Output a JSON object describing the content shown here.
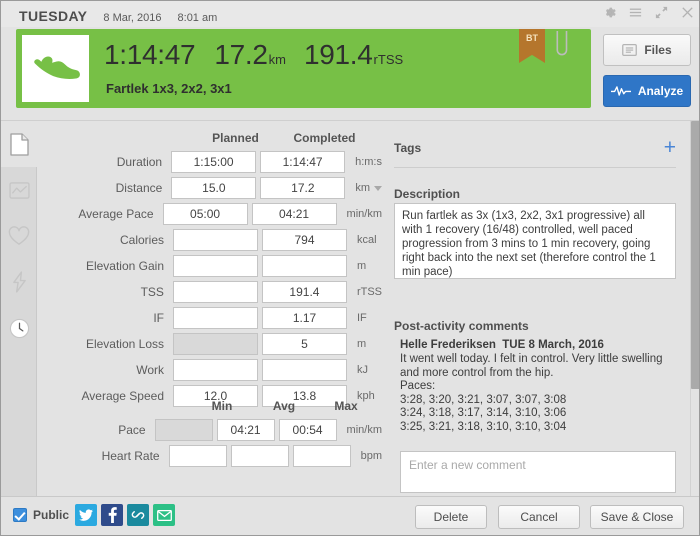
{
  "window": {
    "controls": [
      {
        "name": "gear-icon",
        "label": "Settings"
      },
      {
        "name": "menu-icon",
        "label": "Menu"
      },
      {
        "name": "expand-icon",
        "label": "Expand"
      },
      {
        "name": "close-icon",
        "label": "Close"
      }
    ]
  },
  "header": {
    "day_of_week": "TUESDAY",
    "date": "8 Mar, 2016",
    "time": "8:01 am",
    "banner_color": "#77c046",
    "activity_icon": "running-shoe-icon",
    "stats": [
      {
        "value": "1:14:47",
        "unit": ""
      },
      {
        "value": "17.2",
        "unit": "km"
      },
      {
        "value": "191.4",
        "unit": "rTSS"
      }
    ],
    "subtitle": "Fartlek 1x3, 2x2, 3x1",
    "badge": "BT",
    "attachment_icon": "paperclip-icon",
    "files_button": "Files",
    "analyze_button": "Analyze",
    "analyze_color": "#2f76c7"
  },
  "sidebar": {
    "items": [
      {
        "name": "document-icon",
        "label": "Summary",
        "active": true
      },
      {
        "name": "chart-icon",
        "label": "Graphs",
        "active": false
      },
      {
        "name": "heart-icon",
        "label": "Health",
        "active": false
      },
      {
        "name": "lightning-icon",
        "label": "Power",
        "active": false
      },
      {
        "name": "clock-icon",
        "label": "Laps",
        "active": false
      }
    ]
  },
  "form": {
    "columns": [
      "Planned",
      "Completed"
    ],
    "rows": [
      {
        "label": "Duration",
        "planned": "1:15:00",
        "completed": "1:14:47",
        "unit": "h:m:s",
        "unit_dropdown": false,
        "planned_disabled": false
      },
      {
        "label": "Distance",
        "planned": "15.0",
        "completed": "17.2",
        "unit": "km",
        "unit_dropdown": true,
        "planned_disabled": false
      },
      {
        "label": "Average Pace",
        "planned": "05:00",
        "completed": "04:21",
        "unit": "min/km",
        "unit_dropdown": false,
        "planned_disabled": false
      },
      {
        "label": "Calories",
        "planned": "",
        "completed": "794",
        "unit": "kcal",
        "unit_dropdown": false,
        "planned_disabled": false
      },
      {
        "label": "Elevation Gain",
        "planned": "",
        "completed": "",
        "unit": "m",
        "unit_dropdown": false,
        "planned_disabled": false
      },
      {
        "label": "TSS",
        "planned": "",
        "completed": "191.4",
        "unit": "rTSS",
        "unit_dropdown": false,
        "planned_disabled": false
      },
      {
        "label": "IF",
        "planned": "",
        "completed": "1.17",
        "unit": "IF",
        "unit_dropdown": false,
        "planned_disabled": false
      },
      {
        "label": "Elevation Loss",
        "planned": "",
        "completed": "5",
        "unit": "m",
        "unit_dropdown": false,
        "planned_disabled": true
      },
      {
        "label": "Work",
        "planned": "",
        "completed": "",
        "unit": "kJ",
        "unit_dropdown": false,
        "planned_disabled": false
      },
      {
        "label": "Average Speed",
        "planned": "12.0",
        "completed": "13.8",
        "unit": "kph",
        "unit_dropdown": false,
        "planned_disabled": false
      }
    ],
    "columns2": [
      "Min",
      "Avg",
      "Max"
    ],
    "rows2": [
      {
        "label": "Pace",
        "min": "",
        "avg": "04:21",
        "max": "00:54",
        "unit": "min/km",
        "min_disabled": true
      },
      {
        "label": "Heart Rate",
        "min": "",
        "avg": "",
        "max": "",
        "unit": "bpm",
        "min_disabled": false
      }
    ]
  },
  "right": {
    "tags_title": "Tags",
    "tags_add": "+",
    "description_title": "Description",
    "description_text": "Run fartlek as 3x (1x3, 2x2, 3x1 progressive) all with 1 recovery (16/48) controlled, well paced progression from 3 mins to 1 min recovery, going right back into the next set (therefore control the 1 min pace)",
    "comments_title": "Post-activity comments",
    "comment_author": "Helle Frederiksen",
    "comment_date": "TUE 8 March, 2016",
    "comment_body": "It went well today. I felt in control. Very little swelling and more control from the hip.\nPaces:\n3:28, 3:20, 3:21, 3:07, 3:07, 3:08\n3:24, 3:18, 3:17, 3:14, 3:10, 3:06\n3:25, 3:21, 3:18, 3:10, 3:10, 3:04",
    "new_comment_value": "",
    "new_comment_placeholder": "Enter a new comment"
  },
  "footer": {
    "public_label": "Public",
    "public_checked": true,
    "social": [
      {
        "name": "twitter-share-icon",
        "color": "#2ba9e0",
        "glyph": "twitter"
      },
      {
        "name": "facebook-share-icon",
        "color": "#2f4b8b",
        "glyph": "facebook"
      },
      {
        "name": "link-share-icon",
        "color": "#1b8a9e",
        "glyph": "link"
      },
      {
        "name": "email-share-icon",
        "color": "#2cc086",
        "glyph": "email"
      }
    ],
    "delete_label": "Delete",
    "cancel_label": "Cancel",
    "save_label": "Save & Close"
  }
}
